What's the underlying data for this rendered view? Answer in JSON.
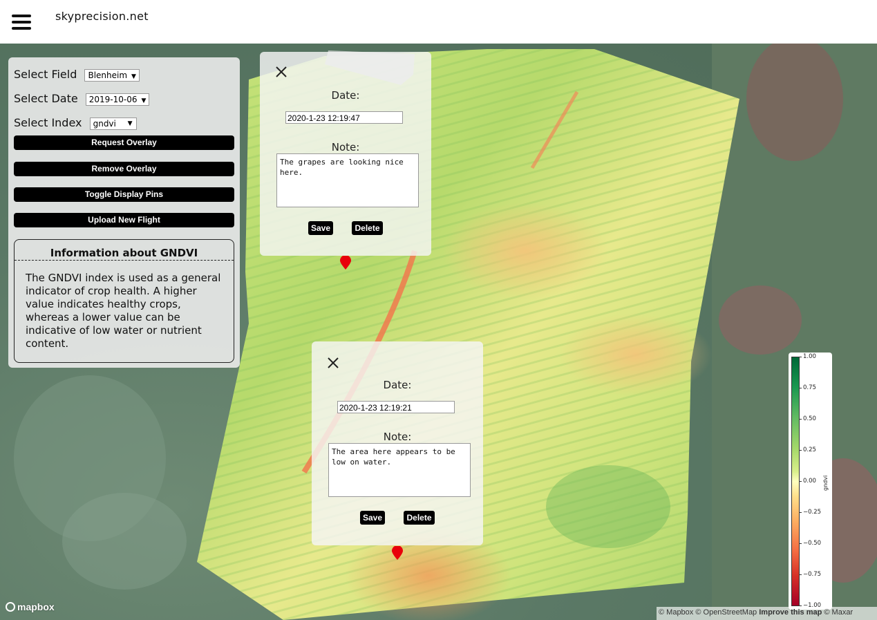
{
  "header": {
    "site_title": "skyprecision.net",
    "menu_icon": "hamburger-menu-icon"
  },
  "sidebar": {
    "field": {
      "label": "Select Field",
      "value": "Blenheim"
    },
    "date": {
      "label": "Select Date",
      "value": "2019-10-06"
    },
    "index": {
      "label": "Select Index",
      "value": "gndvi"
    },
    "buttons": {
      "request_overlay": "Request Overlay",
      "remove_overlay": "Remove Overlay",
      "toggle_pins": "Toggle Display Pins",
      "upload_flight": "Upload New Flight"
    },
    "info": {
      "title": "Information about GNDVI",
      "body": "The GNDVI index is used as a general indicator of crop health. A higher value indicates healthy crops, whereas a lower value can be indicative of low water or nutrient content."
    }
  },
  "popups": [
    {
      "date_label": "Date:",
      "date_value": "2020-1-23 12:19:47",
      "note_label": "Note:",
      "note_text": "The grapes are looking nice here.",
      "save_label": "Save",
      "delete_label": "Delete"
    },
    {
      "date_label": "Date:",
      "date_value": "2020-1-23 12:19:21",
      "note_label": "Note:",
      "note_text": "The area here appears to be low on water.",
      "save_label": "Save",
      "delete_label": "Delete"
    }
  ],
  "legend": {
    "label": "gndvi",
    "ticks": [
      "1.00",
      "0.75",
      "0.50",
      "0.25",
      "0.00",
      "−0.25",
      "−0.50",
      "−0.75",
      "−1.00"
    ],
    "colors": [
      "#006837",
      "#1a9850",
      "#66bd63",
      "#a6d96a",
      "#d9ef8b",
      "#ffffbf",
      "#fee08b",
      "#fdae61",
      "#f46d43",
      "#d73027",
      "#a50026"
    ]
  },
  "map": {
    "logo": "mapbox",
    "attribution": {
      "mapbox": "© Mapbox",
      "osm": "© OpenStreetMap",
      "improve": "Improve this map",
      "maxar": "© Maxar"
    },
    "pin_color": "#e8000b"
  }
}
